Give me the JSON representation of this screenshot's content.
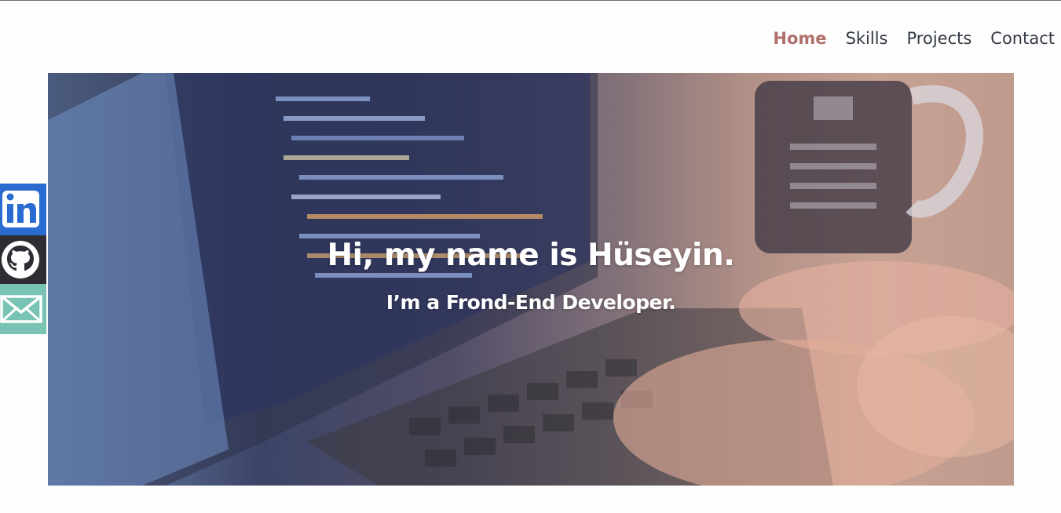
{
  "nav": {
    "items": [
      {
        "label": "Home",
        "active": true
      },
      {
        "label": "Skills",
        "active": false
      },
      {
        "label": "Projects",
        "active": false
      },
      {
        "label": "Contact",
        "active": false
      }
    ]
  },
  "hero": {
    "title": "Hi, my name is Hüseyin.",
    "subtitle": "I’m a Frond-End Developer."
  },
  "social": [
    {
      "name": "linkedin",
      "icon": "linkedin-icon",
      "color": "#2a6bd1"
    },
    {
      "name": "github",
      "icon": "github-icon",
      "color": "#2f2d33"
    },
    {
      "name": "email",
      "icon": "mail-icon",
      "color": "#79c3b5"
    }
  ],
  "colors": {
    "nav_active": "#b0706c",
    "nav_text": "#333a45"
  }
}
